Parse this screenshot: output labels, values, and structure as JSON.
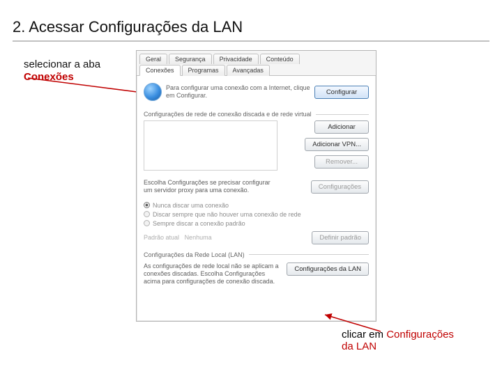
{
  "title": "2. Acessar Configurações da LAN",
  "note_top_prefix": "selecionar a aba ",
  "note_top_bold": "Conexões",
  "note_bottom_plain": "clicar em ",
  "note_bottom_accent1": "Configurações",
  "note_bottom_accent2": "da LAN",
  "tabs": {
    "row1": [
      "Geral",
      "Segurança",
      "Privacidade",
      "Conteúdo"
    ],
    "row2": [
      "Conexões",
      "Programas",
      "Avançadas"
    ],
    "active": "Conexões"
  },
  "dialog": {
    "setup_text": "Para configurar uma conexão com a Internet, clique em Configurar.",
    "btn_configurar": "Configurar",
    "section_dial": "Configurações de rede de conexão discada e de rede virtual",
    "btn_adicionar": "Adicionar",
    "btn_adicionar_vpn": "Adicionar VPN...",
    "btn_remover": "Remover...",
    "proxy_text": "Escolha Configurações se precisar configurar um servidor proxy para uma conexão.",
    "btn_configuracoes": "Configurações",
    "radio1": "Nunca discar uma conexão",
    "radio2": "Discar sempre que não houver uma conexão de rede",
    "radio3": "Sempre discar a conexão padrão",
    "default_label": "Padrão atual",
    "default_value": "Nenhuma",
    "btn_definir_padrao": "Definir padrão",
    "section_lan": "Configurações da Rede Local (LAN)",
    "lan_text": "As configurações de rede local não se aplicam a conexões discadas. Escolha Configurações acima para configurações de conexão discada.",
    "btn_lan": "Configurações da LAN"
  }
}
